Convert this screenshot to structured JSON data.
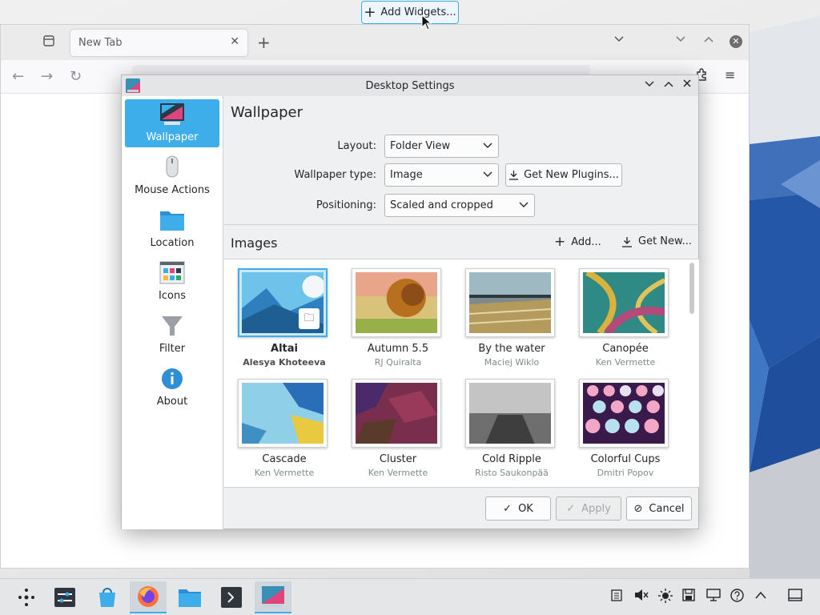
{
  "top_bar": {
    "add_widgets_label": "Add Widgets..."
  },
  "browser": {
    "tab_title": "New Tab",
    "tab_close_glyph": "✕",
    "new_tab_glyph": "+",
    "back_glyph": "←",
    "forward_glyph": "→",
    "reload_glyph": "↻",
    "menu_glyph": "≡"
  },
  "dialog": {
    "title": "Desktop Settings",
    "sidebar": [
      {
        "label": "Wallpaper",
        "icon": "monitor-icon",
        "active": true
      },
      {
        "label": "Mouse Actions",
        "icon": "mouse-icon",
        "active": false
      },
      {
        "label": "Location",
        "icon": "folder-icon",
        "active": false
      },
      {
        "label": "Icons",
        "icon": "icons-grid-icon",
        "active": false
      },
      {
        "label": "Filter",
        "icon": "filter-icon",
        "active": false
      },
      {
        "label": "About",
        "icon": "info-icon",
        "active": false
      }
    ],
    "main": {
      "title": "Wallpaper",
      "layout_label": "Layout:",
      "layout_value": "Folder View",
      "wallpaper_type_label": "Wallpaper type:",
      "wallpaper_type_value": "Image",
      "get_plugins_label": "Get New Plugins...",
      "positioning_label": "Positioning:",
      "positioning_value": "Scaled and cropped",
      "images_title": "Images",
      "add_label": "Add...",
      "get_new_label": "Get New...",
      "wallpapers": [
        {
          "name": "Altai",
          "author": "Alesya Khoteeva",
          "selected": true
        },
        {
          "name": "Autumn 5.5",
          "author": "RJ Quiralta",
          "selected": false
        },
        {
          "name": "By the water",
          "author": "Maciej Wiklo",
          "selected": false
        },
        {
          "name": "Canopée",
          "author": "Ken Vermette",
          "selected": false
        },
        {
          "name": "Cascade",
          "author": "Ken Vermette",
          "selected": false
        },
        {
          "name": "Cluster",
          "author": "Ken Vermette",
          "selected": false
        },
        {
          "name": "Cold Ripple",
          "author": "Risto Saukonpää",
          "selected": false
        },
        {
          "name": "Colorful Cups",
          "author": "Dmitri Popov",
          "selected": false
        }
      ]
    },
    "footer": {
      "ok_label": "OK",
      "apply_label": "Apply",
      "cancel_label": "Cancel"
    }
  },
  "colors": {
    "accent": "#3daee9"
  }
}
